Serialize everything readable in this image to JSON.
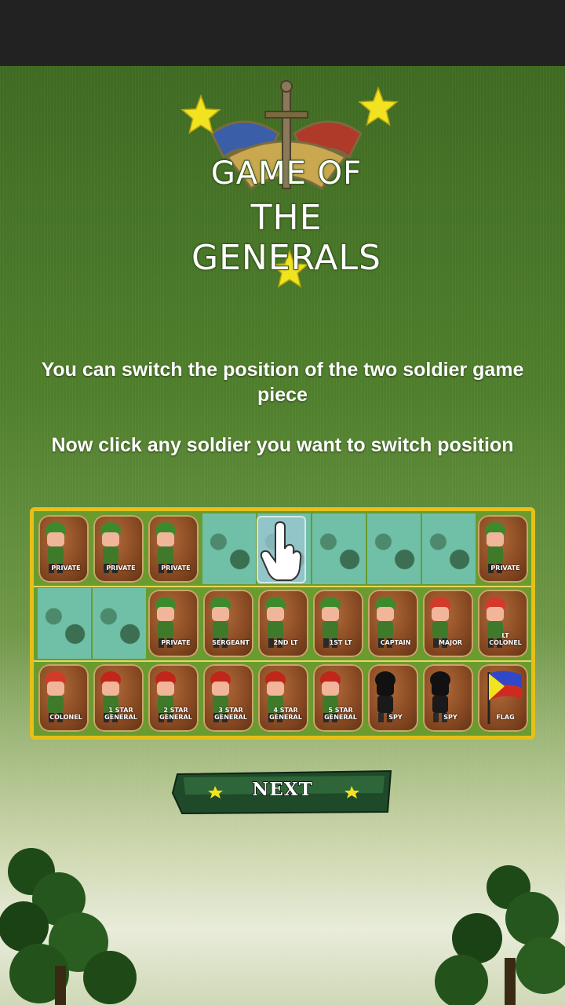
{
  "logo": {
    "line1": "GAME OF",
    "line2": "THE GENERALS"
  },
  "instructions": {
    "line1": "You can switch the position of the two soldier game piece",
    "line2": "Now click any soldier you want to switch position"
  },
  "board": {
    "rows": [
      [
        {
          "type": "piece",
          "label": "PRIVATE"
        },
        {
          "type": "piece",
          "label": "PRIVATE"
        },
        {
          "type": "piece",
          "label": "PRIVATE"
        },
        {
          "type": "empty"
        },
        {
          "type": "empty",
          "selected": true
        },
        {
          "type": "empty"
        },
        {
          "type": "empty"
        },
        {
          "type": "empty"
        },
        {
          "type": "piece",
          "label": "PRIVATE"
        }
      ],
      [
        {
          "type": "empty"
        },
        {
          "type": "empty"
        },
        {
          "type": "piece",
          "label": "PRIVATE"
        },
        {
          "type": "piece",
          "label": "SERGEANT"
        },
        {
          "type": "piece",
          "label": "2ND LT"
        },
        {
          "type": "piece",
          "label": "1ST LT"
        },
        {
          "type": "piece",
          "label": "CAPTAIN"
        },
        {
          "type": "piece",
          "label": "MAJOR"
        },
        {
          "type": "piece",
          "label": "LT COLONEL"
        }
      ],
      [
        {
          "type": "piece",
          "label": "COLONEL"
        },
        {
          "type": "piece",
          "label": "1 STAR GENERAL"
        },
        {
          "type": "piece",
          "label": "2 STAR GENERAL"
        },
        {
          "type": "piece",
          "label": "3 STAR GENERAL"
        },
        {
          "type": "piece",
          "label": "4 STAR GENERAL"
        },
        {
          "type": "piece",
          "label": "5 STAR GENERAL"
        },
        {
          "type": "piece",
          "label": "SPY"
        },
        {
          "type": "piece",
          "label": "SPY"
        },
        {
          "type": "piece",
          "label": "FLAG"
        }
      ]
    ]
  },
  "next_button": {
    "label": "NEXT"
  },
  "colors": {
    "board_border": "#e6c019",
    "star": "#f2e321",
    "grass": "#6fc0a6"
  },
  "icons": [
    "star-icon",
    "sword-icon",
    "soldier-icon",
    "hand-pointer-icon",
    "flag-icon",
    "tree-icon"
  ]
}
